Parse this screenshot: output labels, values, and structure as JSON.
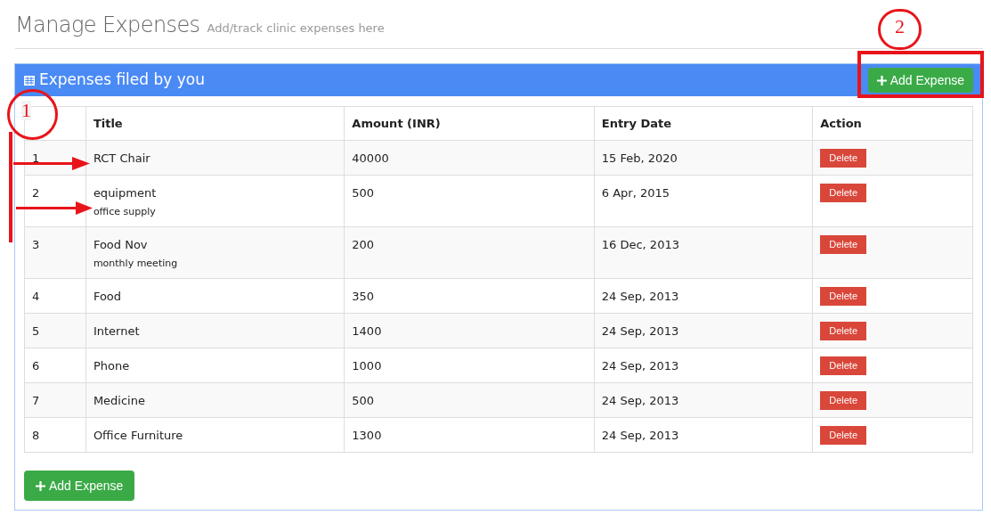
{
  "page": {
    "title": "Manage Expenses",
    "subtitle": "Add/track clinic expenses here"
  },
  "panel": {
    "title": "Expenses filed by you",
    "add_button": "Add Expense"
  },
  "table": {
    "columns": [
      "Title",
      "Amount (INR)",
      "Entry Date",
      "Action"
    ],
    "rows": [
      {
        "index": "1",
        "title": "RCT Chair",
        "amount": "40000",
        "date": "15 Feb, 2020",
        "action": "Delete"
      },
      {
        "index": "2",
        "title": "equipment",
        "note": "office supply",
        "amount": "500",
        "date": "6 Apr, 2015",
        "action": "Delete"
      },
      {
        "index": "3",
        "title": "Food Nov",
        "note": "monthly meeting",
        "amount": "200",
        "date": "16 Dec, 2013",
        "action": "Delete"
      },
      {
        "index": "4",
        "title": "Food",
        "amount": "350",
        "date": "24 Sep, 2013",
        "action": "Delete"
      },
      {
        "index": "5",
        "title": "Internet",
        "amount": "1400",
        "date": "24 Sep, 2013",
        "action": "Delete"
      },
      {
        "index": "6",
        "title": "Phone",
        "amount": "1000",
        "date": "24 Sep, 2013",
        "action": "Delete"
      },
      {
        "index": "7",
        "title": "Medicine",
        "amount": "500",
        "date": "24 Sep, 2013",
        "action": "Delete"
      },
      {
        "index": "8",
        "title": "Office Furniture",
        "amount": "1300",
        "date": "24 Sep, 2013",
        "action": "Delete"
      }
    ]
  },
  "bottom_button": "Add Expense",
  "annotations": [
    "1",
    "2"
  ]
}
